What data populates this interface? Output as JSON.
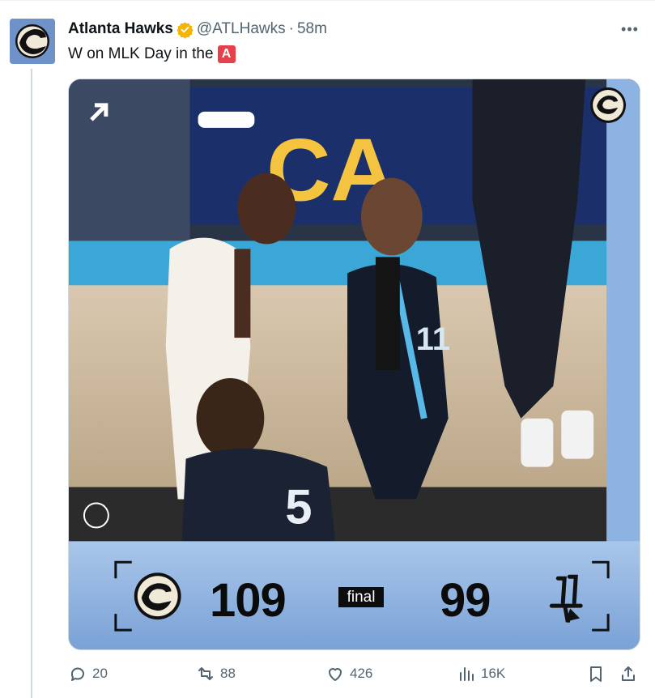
{
  "tweet": {
    "author_name": "Atlanta Hawks",
    "handle": "@ATLHawks",
    "separator": "·",
    "time": "58m",
    "more_label": "•••",
    "text": "W on MLK Day in the",
    "text_badge": "A"
  },
  "scoreboard": {
    "home_score": "109",
    "status": "final",
    "away_score": "99"
  },
  "actions": {
    "replies": "20",
    "reposts": "88",
    "likes": "426",
    "views": "16K"
  },
  "colors": {
    "accent_red": "#e8404a",
    "verified_gold": "#f5b400",
    "muted_text": "#536471"
  },
  "icons": [
    "hawks-logo-icon",
    "verified-badge-icon",
    "more-icon",
    "reply-icon",
    "repost-icon",
    "like-icon",
    "views-icon",
    "bookmark-icon",
    "share-icon"
  ]
}
